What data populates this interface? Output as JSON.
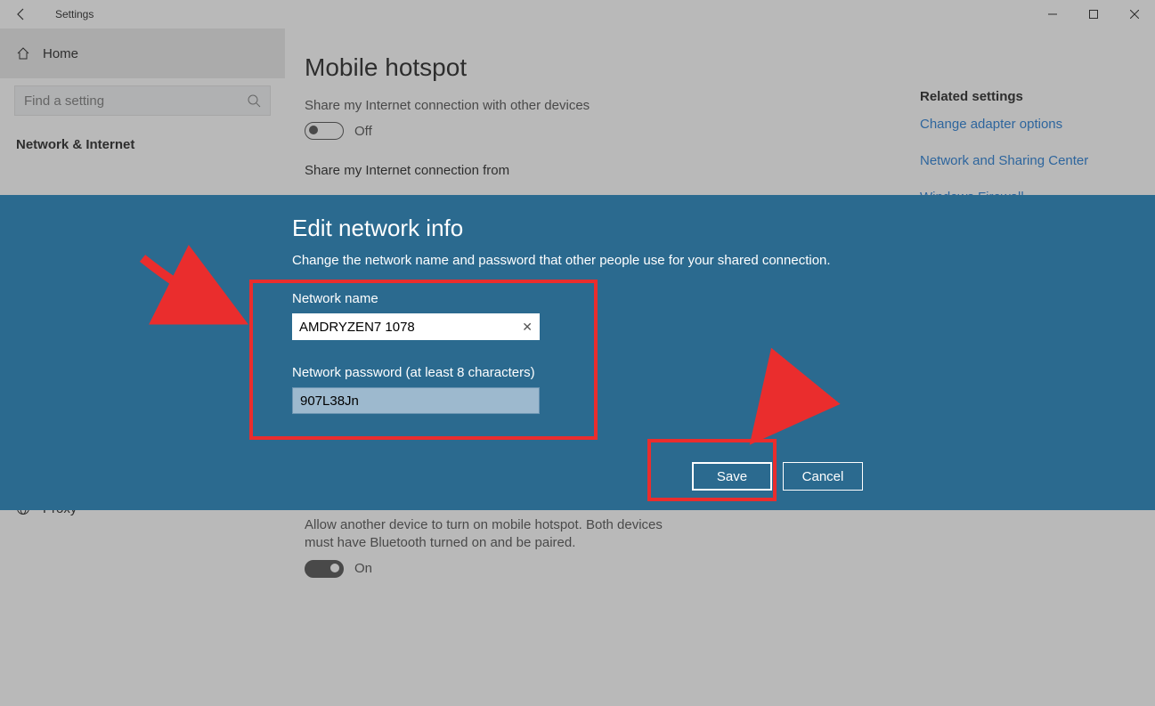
{
  "window": {
    "title": "Settings"
  },
  "sidebar": {
    "home_label": "Home",
    "search_placeholder": "Find a setting",
    "section_label": "Network & Internet",
    "proxy_label": "Proxy"
  },
  "main": {
    "page_title": "Mobile hotspot",
    "share_label": "Share my Internet connection with other devices",
    "share_toggle_state": "Off",
    "share_from_label": "Share my Internet connection from",
    "remote_text": "Allow another device to turn on mobile hotspot. Both devices must have Bluetooth turned on and be paired.",
    "remote_toggle_state": "On"
  },
  "related": {
    "heading": "Related settings",
    "links": [
      "Change adapter options",
      "Network and Sharing Center",
      "Windows Firewall"
    ]
  },
  "modal": {
    "title": "Edit network info",
    "description": "Change the network name and password that other people use for your shared connection.",
    "name_label": "Network name",
    "name_value": "AMDRYZEN7 1078",
    "password_label": "Network password (at least 8 characters)",
    "password_value": "907L38Jn",
    "save_label": "Save",
    "cancel_label": "Cancel"
  }
}
